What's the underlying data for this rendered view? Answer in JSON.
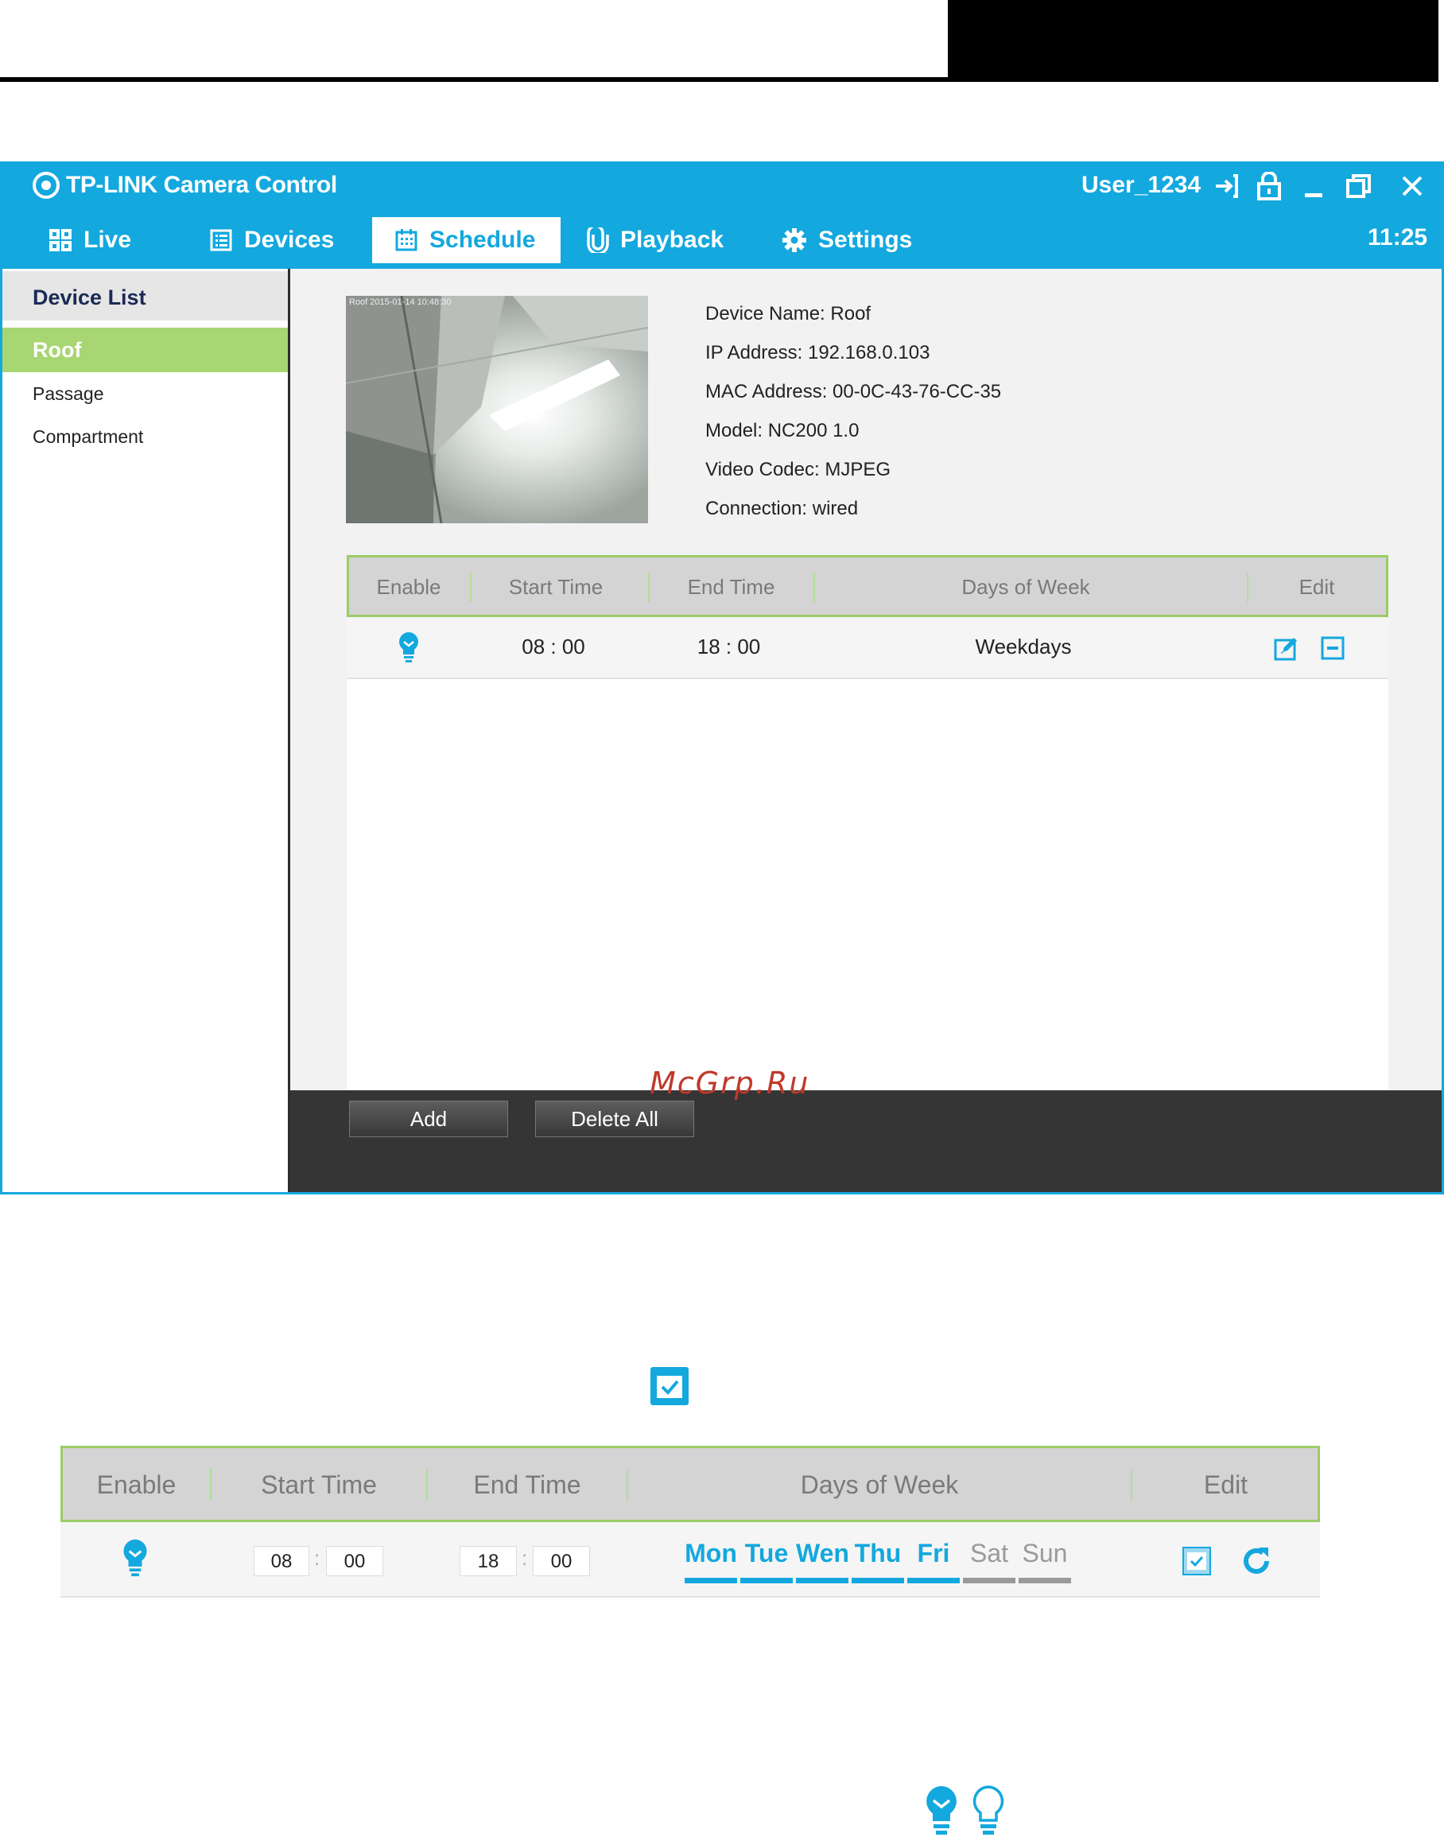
{
  "app": {
    "title": "TP-LINK Camera Control",
    "user": "User_1234",
    "clock": "11:25"
  },
  "nav": {
    "tabs": [
      {
        "label": "Live",
        "icon": "grid-icon"
      },
      {
        "label": "Devices",
        "icon": "list-icon"
      },
      {
        "label": "Schedule",
        "icon": "calendar-icon",
        "active": true
      },
      {
        "label": "Playback",
        "icon": "clip-icon"
      },
      {
        "label": "Settings",
        "icon": "gear-icon"
      }
    ]
  },
  "sidebar": {
    "heading": "Device List",
    "items": [
      {
        "label": "Roof",
        "active": true
      },
      {
        "label": "Passage"
      },
      {
        "label": "Compartment"
      }
    ]
  },
  "device": {
    "preview_stamp": "Roof 2015-01-14 10:48:30",
    "info": [
      "Device Name: Roof",
      "IP Address: 192.168.0.103",
      "MAC Address: 00-0C-43-76-CC-35",
      "Model: NC200 1.0",
      "Video Codec: MJPEG",
      "Connection: wired"
    ]
  },
  "schedule": {
    "headers": [
      "Enable",
      "Start Time",
      "End Time",
      "Days of Week",
      "Edit"
    ],
    "rows": [
      {
        "start": "08 : 00",
        "end": "18 : 00",
        "days": "Weekdays",
        "enabled": true
      }
    ]
  },
  "footer": {
    "add_label": "Add",
    "delete_all_label": "Delete All"
  },
  "watermark": "McGrp.Ru",
  "edit_row": {
    "headers": [
      "Enable",
      "Start Time",
      "End Time",
      "Days of Week",
      "Edit"
    ],
    "start_hour": "08",
    "start_min": "00",
    "end_hour": "18",
    "end_min": "00",
    "colon": ":",
    "days": [
      {
        "label": "Mon",
        "on": true
      },
      {
        "label": "Tue",
        "on": true
      },
      {
        "label": "Wen",
        "on": true
      },
      {
        "label": "Thu",
        "on": true
      },
      {
        "label": "Fri",
        "on": true
      },
      {
        "label": "Sat",
        "on": false
      },
      {
        "label": "Sun",
        "on": false
      }
    ]
  },
  "colors": {
    "accent": "#13a8de",
    "selected": "#a8d673",
    "header_border": "#9ccc65",
    "footer_bg": "#353535"
  }
}
